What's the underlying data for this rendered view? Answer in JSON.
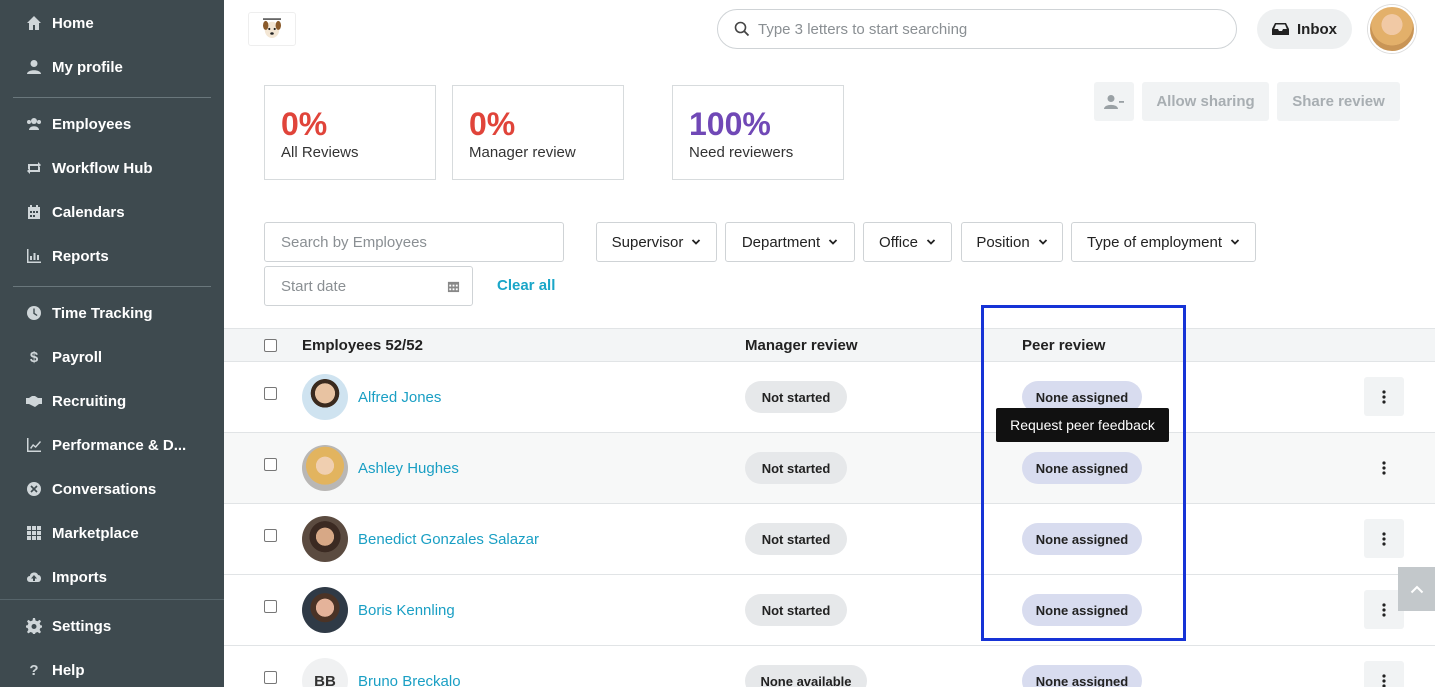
{
  "sidebar": {
    "items": [
      {
        "label": "Home",
        "icon": "home-icon"
      },
      {
        "label": "My profile",
        "icon": "user-icon"
      },
      {
        "label": "Employees",
        "icon": "users-icon"
      },
      {
        "label": "Workflow Hub",
        "icon": "workflow-icon"
      },
      {
        "label": "Calendars",
        "icon": "calendar-icon"
      },
      {
        "label": "Reports",
        "icon": "chart-icon"
      },
      {
        "label": "Time Tracking",
        "icon": "clock-icon"
      },
      {
        "label": "Payroll",
        "icon": "dollar-icon"
      },
      {
        "label": "Recruiting",
        "icon": "handshake-icon"
      },
      {
        "label": "Performance & D...",
        "icon": "trend-icon"
      },
      {
        "label": "Conversations",
        "icon": "chat-icon"
      },
      {
        "label": "Marketplace",
        "icon": "grid-icon"
      },
      {
        "label": "Imports",
        "icon": "cloud-upload-icon"
      },
      {
        "label": "Settings",
        "icon": "gear-icon"
      },
      {
        "label": "Help",
        "icon": "question-icon"
      }
    ]
  },
  "header": {
    "search_placeholder": "Type 3 letters to start searching",
    "inbox_label": "Inbox"
  },
  "stats": [
    {
      "value": "0%",
      "label": "All Reviews",
      "color": "#e0443a"
    },
    {
      "value": "0%",
      "label": "Manager review",
      "color": "#e0443a"
    },
    {
      "value": "100%",
      "label": "Need reviewers",
      "color": "#7048b6"
    }
  ],
  "actions": {
    "allow_sharing": "Allow sharing",
    "share_review": "Share review"
  },
  "filters": {
    "search_placeholder": "Search by Employees",
    "start_date_placeholder": "Start date",
    "clear_all": "Clear all",
    "dropdowns": [
      "Supervisor",
      "Department",
      "Office",
      "Position",
      "Type of employment"
    ]
  },
  "table": {
    "headers": {
      "employees": "Employees 52/52",
      "manager_review": "Manager review",
      "peer_review": "Peer review"
    },
    "rows": [
      {
        "name": "Alfred Jones",
        "manager_review": "Not started",
        "peer_review": "None assigned"
      },
      {
        "name": "Ashley Hughes",
        "manager_review": "Not started",
        "peer_review": "None assigned"
      },
      {
        "name": "Benedict Gonzales Salazar",
        "manager_review": "Not started",
        "peer_review": "None assigned"
      },
      {
        "name": "Boris Kennling",
        "manager_review": "Not started",
        "peer_review": "None assigned"
      },
      {
        "name": "Bruno Breckalo",
        "initials": "BB",
        "manager_review": "None available",
        "peer_review": "None assigned"
      }
    ]
  },
  "tooltip": "Request peer feedback",
  "colors": {
    "sidebar_bg": "#3e4a4f",
    "link": "#1a9fc4",
    "highlight": "#1633d6"
  }
}
